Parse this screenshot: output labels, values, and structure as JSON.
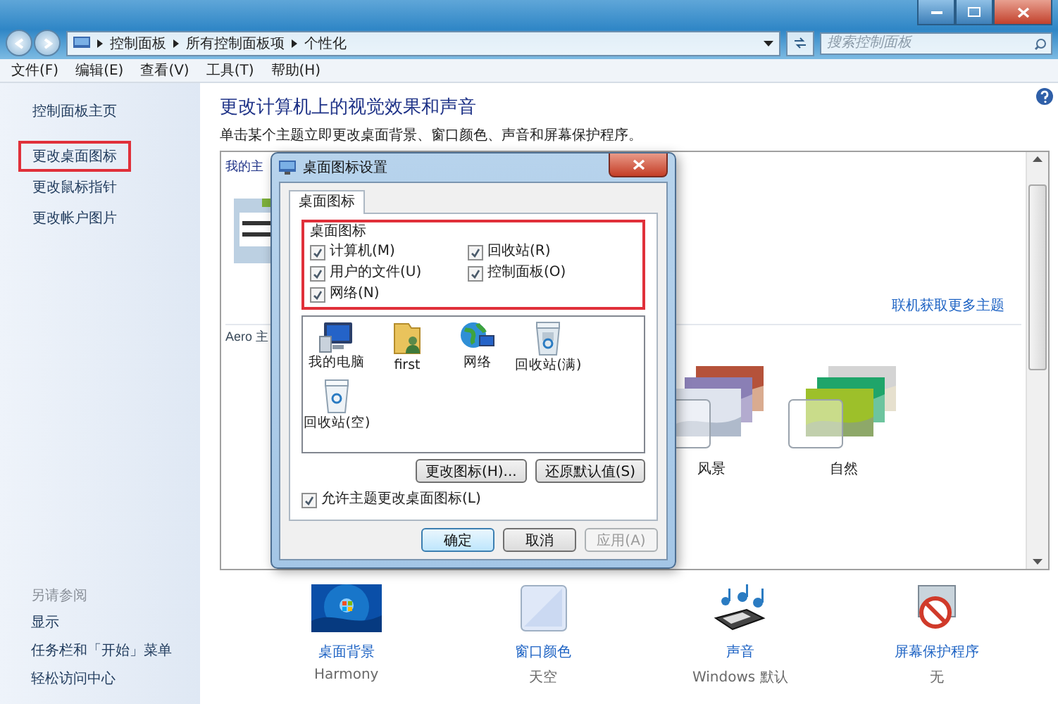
{
  "address_bar": {
    "breadcrumbs": [
      "控制面板",
      "所有控制面板项",
      "个性化"
    ]
  },
  "search": {
    "placeholder": "搜索控制面板"
  },
  "menu": [
    "文件(F)",
    "编辑(E)",
    "查看(V)",
    "工具(T)",
    "帮助(H)"
  ],
  "sidebar": {
    "items": [
      {
        "label": "控制面板主页",
        "highlighted": false
      },
      {
        "label": "更改桌面图标",
        "highlighted": true
      },
      {
        "label": "更改鼠标指针",
        "highlighted": false
      },
      {
        "label": "更改帐户图片",
        "highlighted": false
      }
    ],
    "see_also": {
      "title": "另请参阅",
      "items": [
        "显示",
        "任务栏和「开始」菜单",
        "轻松访问中心"
      ]
    }
  },
  "main": {
    "heading": "更改计算机上的视觉效果和声音",
    "subtitle": "单击某个主题立即更改桌面背景、窗口颜色、声音和屏幕保护程序。",
    "my_themes_title": "我的主",
    "online_link": "联机获取更多主题",
    "aero_title": "Aero 主",
    "aero_themes": [
      {
        "name": "风景",
        "kind": "landscape"
      },
      {
        "name": "自然",
        "kind": "nature"
      }
    ]
  },
  "bottom_settings": [
    {
      "kind": "background",
      "label": "桌面背景",
      "value": "Harmony"
    },
    {
      "kind": "color",
      "label": "窗口颜色",
      "value": "天空"
    },
    {
      "kind": "sound",
      "label": "声音",
      "value": "Windows 默认"
    },
    {
      "kind": "screensaver",
      "label": "屏幕保护程序",
      "value": "无"
    }
  ],
  "dialog": {
    "title": "桌面图标设置",
    "tabs": [
      {
        "label": "桌面图标",
        "selected": true
      }
    ],
    "group": {
      "title": "桌面图标",
      "highlighted": true,
      "checkboxes": [
        {
          "label": "计算机(M)",
          "checked": true
        },
        {
          "label": "回收站(R)",
          "checked": true
        },
        {
          "label": "用户的文件(U)",
          "checked": true
        },
        {
          "label": "控制面板(O)",
          "checked": true
        },
        {
          "label": "网络(N)",
          "checked": true
        }
      ]
    },
    "icons": [
      {
        "kind": "computer",
        "label": "我的电脑"
      },
      {
        "kind": "user-folder",
        "label": "first"
      },
      {
        "kind": "network",
        "label": "网络"
      },
      {
        "kind": "bin-full",
        "label": "回收站(满)"
      },
      {
        "kind": "bin-empty",
        "label": "回收站(空)"
      }
    ],
    "icon_buttons": [
      "更改图标(H)...",
      "还原默认值(S)"
    ],
    "allow_themes": {
      "label": "允许主题更改桌面图标(L)",
      "checked": true
    },
    "buttons": [
      {
        "label": "确定",
        "disabled": false,
        "default": true
      },
      {
        "label": "取消",
        "disabled": false,
        "default": false
      },
      {
        "label": "应用(A)",
        "disabled": true,
        "default": false
      }
    ]
  }
}
